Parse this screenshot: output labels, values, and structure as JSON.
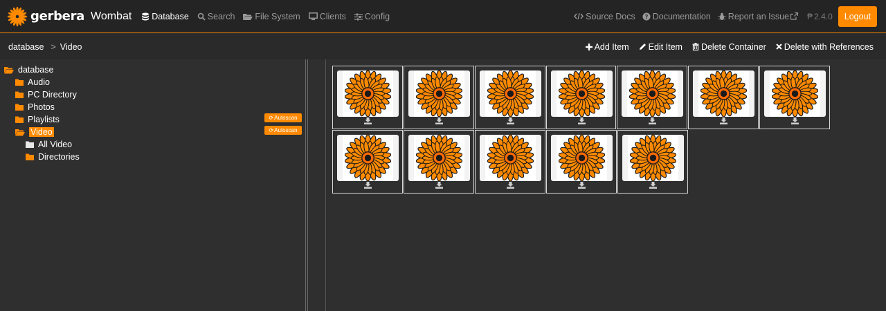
{
  "app": {
    "brand": "gerbera",
    "subtitle": "Wombat",
    "version": "2.4.0",
    "accent_color": "#ff8a00"
  },
  "nav": {
    "items": [
      {
        "label": "Database",
        "icon": "database-icon",
        "active": true
      },
      {
        "label": "Search",
        "icon": "search-icon"
      },
      {
        "label": "File System",
        "icon": "folder-open-icon"
      },
      {
        "label": "Clients",
        "icon": "monitor-icon"
      },
      {
        "label": "Config",
        "icon": "sliders-icon"
      }
    ],
    "right": [
      {
        "label": "Source Docs",
        "icon": "code-icon"
      },
      {
        "label": "Documentation",
        "icon": "question-circle-icon"
      },
      {
        "label": "Report an Issue",
        "icon": "bug-icon",
        "trailing_icon": "external-link-icon"
      }
    ],
    "logout": "Logout"
  },
  "breadcrumb": {
    "root": "database",
    "separator": ">",
    "current": "Video"
  },
  "actions": [
    {
      "label": "Add Item",
      "icon": "plus-icon"
    },
    {
      "label": "Edit Item",
      "icon": "pencil-icon"
    },
    {
      "label": "Delete Container",
      "icon": "trash-icon"
    },
    {
      "label": "Delete with References",
      "icon": "times-icon"
    }
  ],
  "tree": {
    "items": [
      {
        "label": "database",
        "depth": 0,
        "icon": "folder-open-icon"
      },
      {
        "label": "Audio",
        "depth": 1,
        "icon": "folder-icon"
      },
      {
        "label": "PC Directory",
        "depth": 1,
        "icon": "folder-icon"
      },
      {
        "label": "Photos",
        "depth": 1,
        "icon": "folder-icon"
      },
      {
        "label": "Playlists",
        "depth": 1,
        "icon": "folder-icon",
        "badge": "Autoscan"
      },
      {
        "label": "Video",
        "depth": 1,
        "icon": "folder-open-icon",
        "selected": true,
        "badge": "Autoscan"
      },
      {
        "label": "All Video",
        "depth": 2,
        "icon": "folder-icon",
        "white": true
      },
      {
        "label": "Directories",
        "depth": 2,
        "icon": "folder-icon"
      }
    ]
  },
  "items": {
    "count": 12,
    "thumbnail_icon": "gerbera-flower-icon",
    "download_icon": "download-icon"
  }
}
